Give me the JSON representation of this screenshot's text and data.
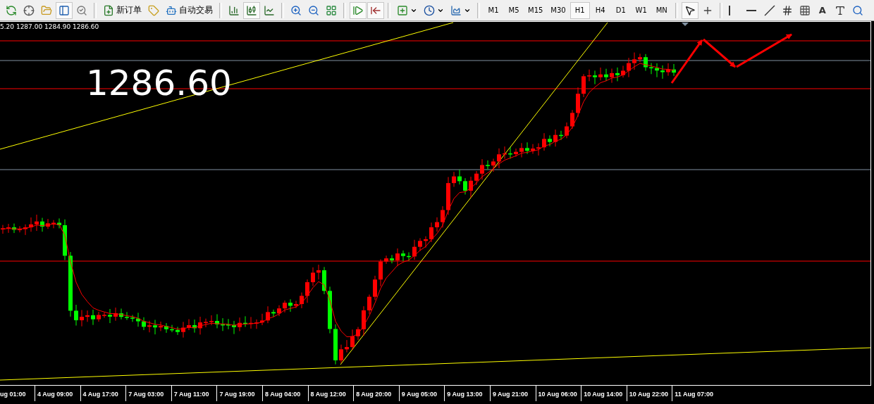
{
  "toolbar": {
    "groups": [
      [
        {
          "kind": "icon",
          "selected": false
        },
        {
          "kind": "icon",
          "selected": false
        },
        {
          "kind": "icon",
          "selected": false
        },
        {
          "kind": "icon",
          "selected": true
        },
        {
          "kind": "icon",
          "selected": false
        }
      ],
      [
        {
          "kind": "text",
          "label": "新订单"
        },
        {
          "kind": "icon",
          "selected": false
        },
        {
          "kind": "text",
          "label": "自动交易"
        }
      ],
      [
        {
          "kind": "icon",
          "selected": false
        },
        {
          "kind": "icon",
          "selected": true
        },
        {
          "kind": "icon",
          "selected": false
        }
      ],
      [
        {
          "kind": "icon",
          "selected": false
        },
        {
          "kind": "icon",
          "selected": false
        },
        {
          "kind": "icon",
          "selected": false
        }
      ],
      [
        {
          "kind": "icon",
          "selected": true
        },
        {
          "kind": "icon",
          "selected": true
        }
      ],
      [
        {
          "kind": "dropdown"
        },
        {
          "kind": "dropdown"
        },
        {
          "kind": "dropdown"
        }
      ],
      [
        {
          "kind": "timeframe",
          "label": "M1",
          "selected": false
        },
        {
          "kind": "timeframe",
          "label": "M5",
          "selected": false
        },
        {
          "kind": "timeframe",
          "label": "M15",
          "selected": false
        },
        {
          "kind": "timeframe",
          "label": "M30",
          "selected": false
        },
        {
          "kind": "timeframe",
          "label": "H1",
          "selected": true
        },
        {
          "kind": "timeframe",
          "label": "H4",
          "selected": false
        },
        {
          "kind": "timeframe",
          "label": "D1",
          "selected": false
        },
        {
          "kind": "timeframe",
          "label": "W1",
          "selected": false
        },
        {
          "kind": "timeframe",
          "label": "MN",
          "selected": false
        }
      ],
      [
        {
          "kind": "icon",
          "selected": true
        },
        {
          "kind": "icon",
          "selected": false
        }
      ],
      [
        {
          "kind": "icon",
          "selected": false
        },
        {
          "kind": "icon",
          "selected": false
        },
        {
          "kind": "icon",
          "selected": false
        },
        {
          "kind": "icon",
          "selected": false
        },
        {
          "kind": "icon",
          "selected": false
        },
        {
          "kind": "letter",
          "label": "A"
        },
        {
          "kind": "icon",
          "selected": false
        },
        {
          "kind": "icon",
          "selected": false
        }
      ]
    ]
  },
  "chart": {
    "ohlc": "5.20 1287.00 1284.90 1286.60",
    "price_label": "1286.60",
    "time_axis": [
      "ug 01:00",
      "4 Aug 09:00",
      "4 Aug 17:00",
      "7 Aug 03:00",
      "7 Aug 11:00",
      "7 Aug 19:00",
      "8 Aug 04:00",
      "8 Aug 12:00",
      "8 Aug 20:00",
      "9 Aug 05:00",
      "9 Aug 13:00",
      "9 Aug 21:00",
      "10 Aug 06:00",
      "10 Aug 14:00",
      "10 Aug 22:00",
      "11 Aug 07:00"
    ]
  }
}
